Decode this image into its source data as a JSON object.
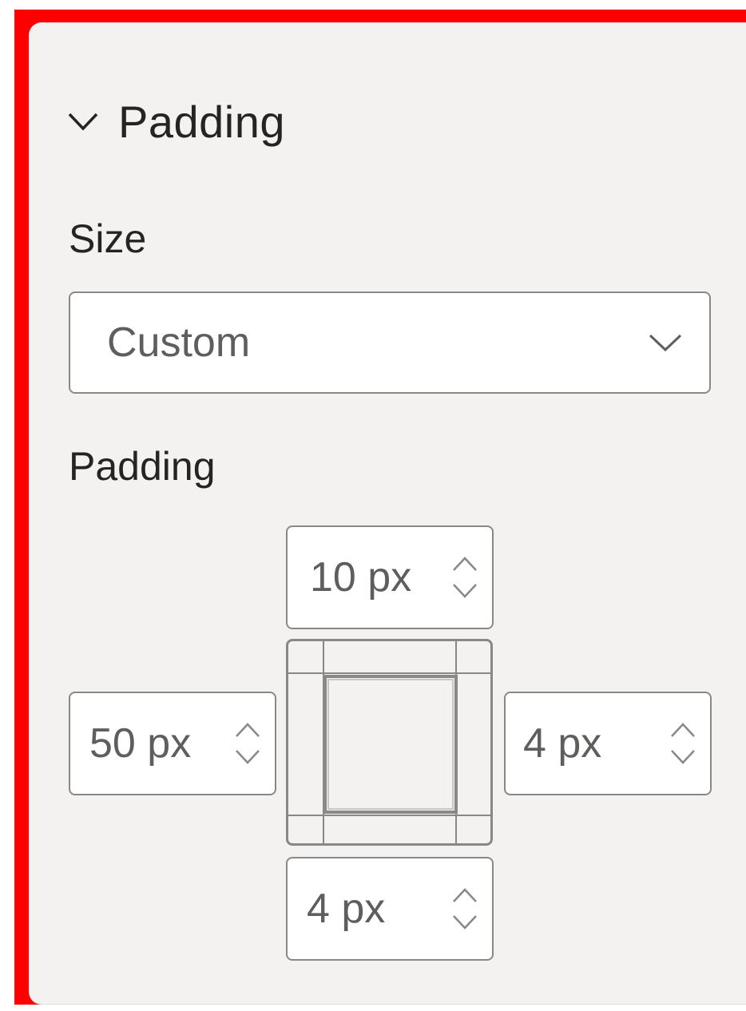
{
  "section": {
    "title": "Padding",
    "expanded": true,
    "chevron_icon": "chevron-down-icon"
  },
  "size": {
    "label": "Size",
    "selected": "Custom",
    "dropdown_icon": "chevron-down-icon"
  },
  "padding": {
    "label": "Padding",
    "top": "10 px",
    "left": "50 px",
    "right": "4 px",
    "bottom": "4 px"
  },
  "colors": {
    "highlight_border": "#ff0000",
    "panel_bg": "#f3f2f1",
    "text": "#252423",
    "value_text": "#605e5c",
    "border": "#8a8886"
  }
}
